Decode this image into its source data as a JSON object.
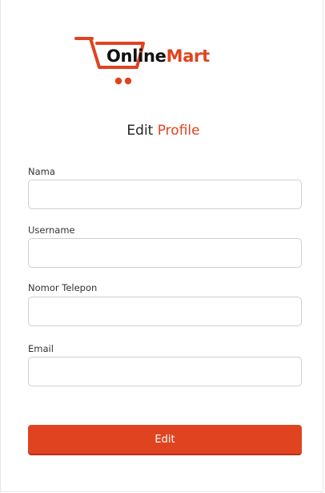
{
  "brand": {
    "name_part1": "Online",
    "name_part2": "Mart",
    "accent_color": "#e0431f",
    "logo_icon": "shopping-cart-icon"
  },
  "page": {
    "title_part1": "Edit ",
    "title_part2": "Profile"
  },
  "form": {
    "fields": [
      {
        "label": "Nama",
        "value": "",
        "placeholder": ""
      },
      {
        "label": "Username",
        "value": "",
        "placeholder": ""
      },
      {
        "label": "Nomor Telepon",
        "value": "",
        "placeholder": ""
      },
      {
        "label": "Email",
        "value": "",
        "placeholder": ""
      }
    ],
    "submit_label": "Edit"
  }
}
